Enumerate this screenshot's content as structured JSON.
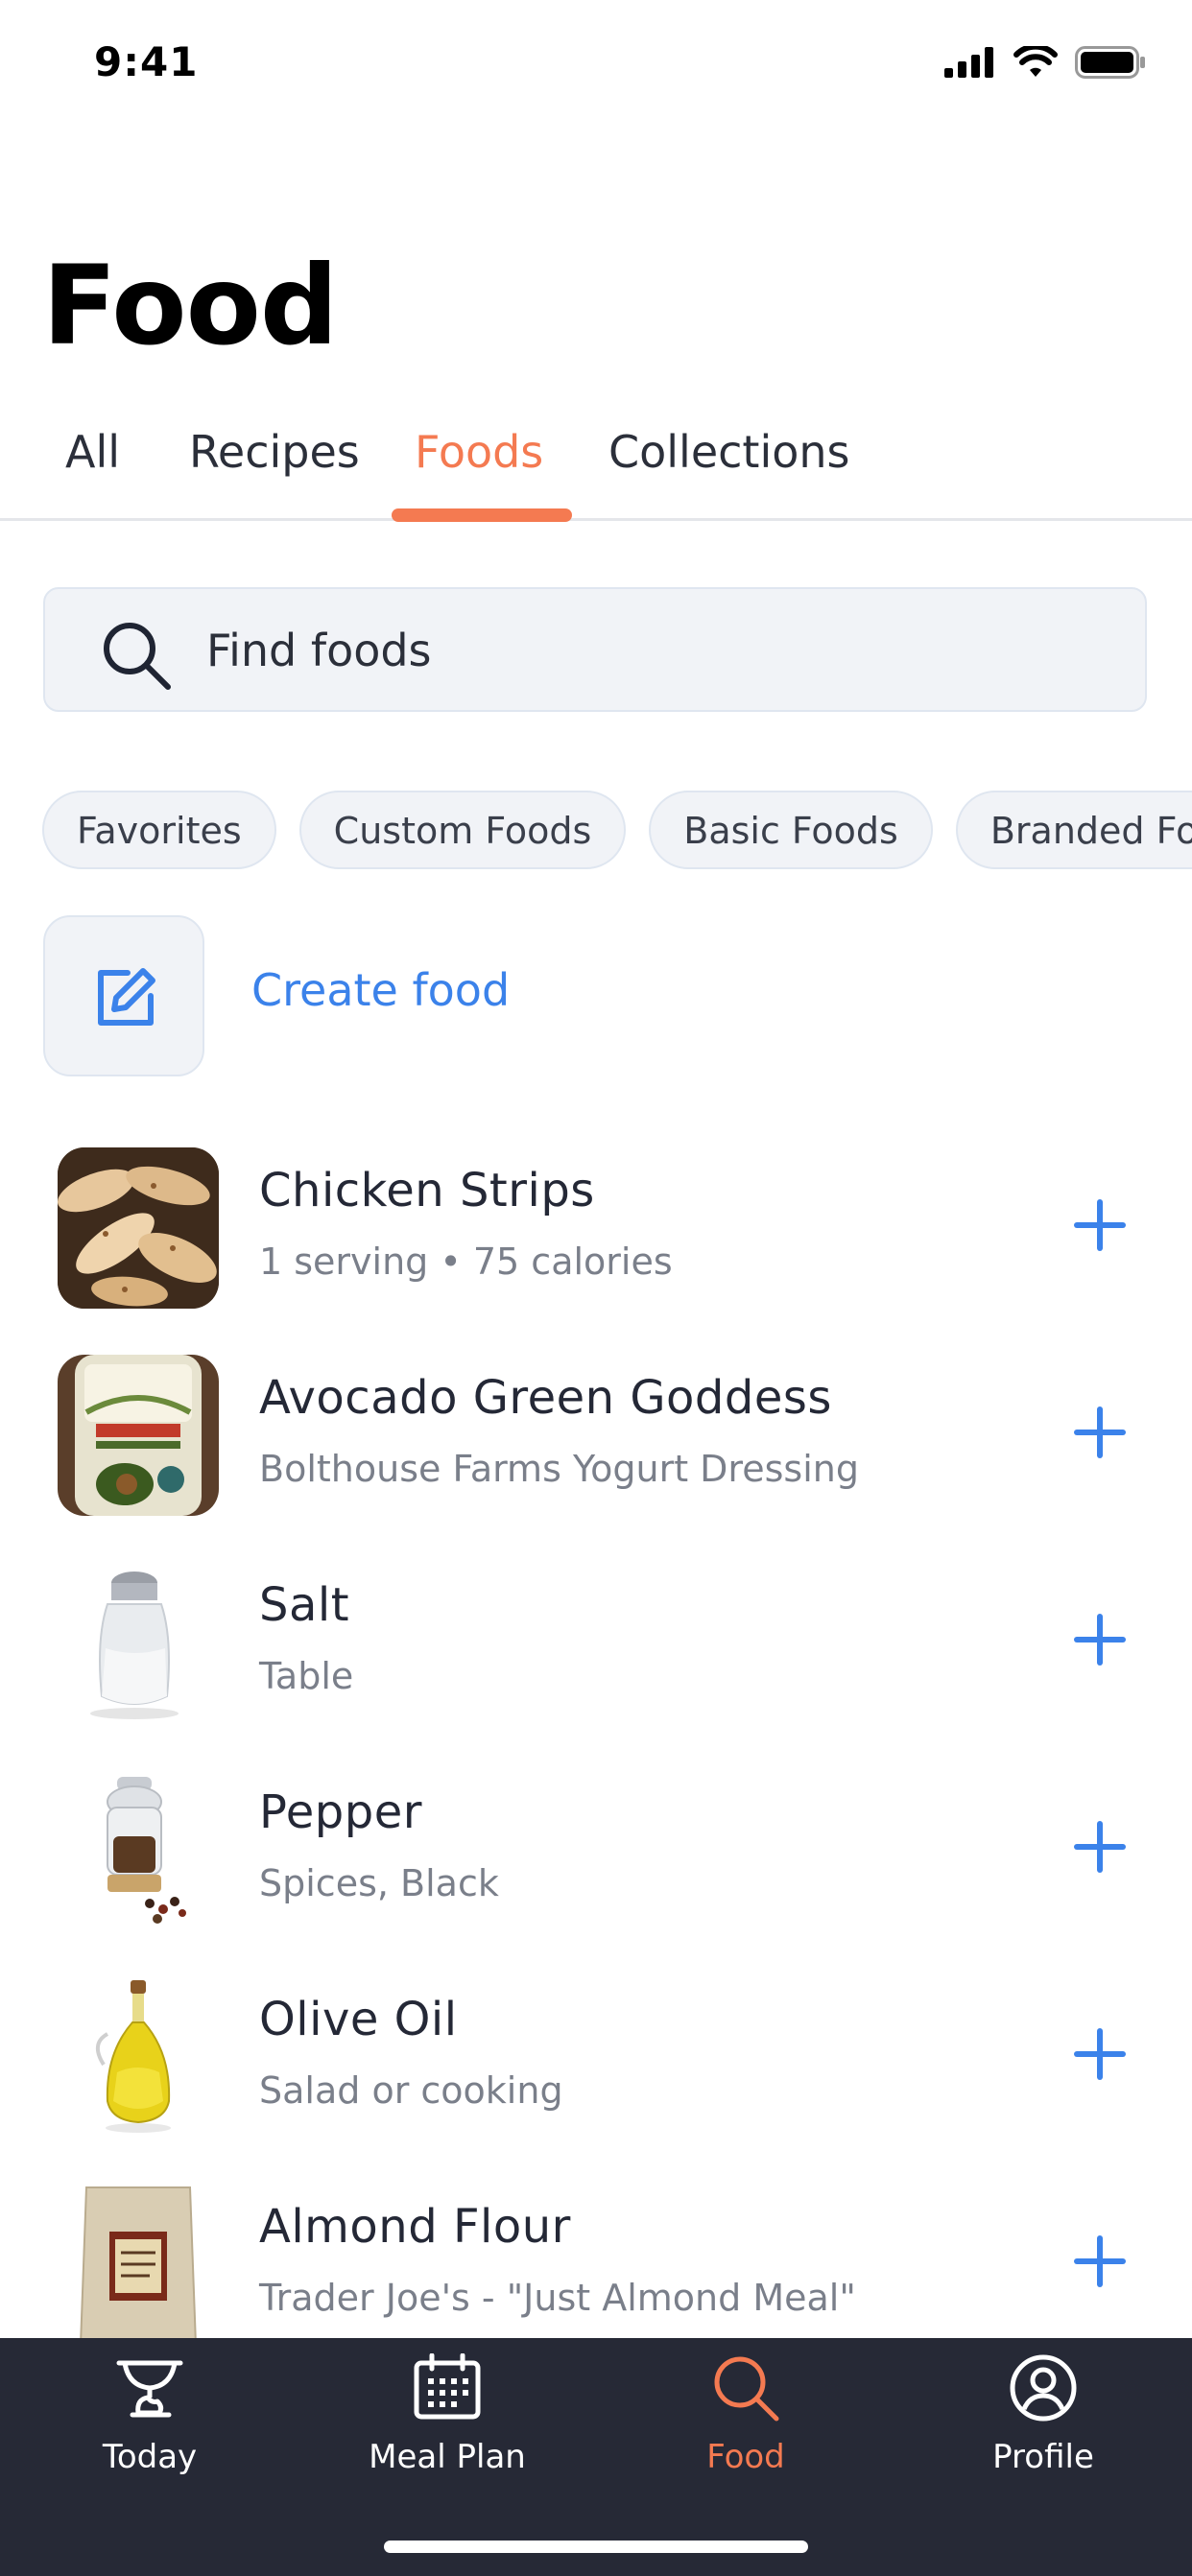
{
  "status_bar": {
    "time": "9:41"
  },
  "page": {
    "title": "Food"
  },
  "tabs": [
    {
      "label": "All"
    },
    {
      "label": "Recipes"
    },
    {
      "label": "Foods"
    },
    {
      "label": "Collections"
    }
  ],
  "active_tab": "Foods",
  "search": {
    "placeholder": "Find foods",
    "value": ""
  },
  "chips": [
    {
      "label": "Favorites"
    },
    {
      "label": "Custom Foods"
    },
    {
      "label": "Basic Foods"
    },
    {
      "label": "Branded Foods"
    }
  ],
  "create_food": {
    "label": "Create food",
    "icon": "edit-icon"
  },
  "foods": [
    {
      "name": "Chicken Strips",
      "subtitle": "1 serving • 75 calories",
      "image": "chicken-strips-photo"
    },
    {
      "name": "Avocado Green Goddess",
      "subtitle": "Bolthouse Farms Yogurt Dressing",
      "image": "dressing-bottle-photo"
    },
    {
      "name": "Salt",
      "subtitle": "Table",
      "image": "salt-shaker-photo"
    },
    {
      "name": "Pepper",
      "subtitle": "Spices, Black",
      "image": "pepper-grinder-photo"
    },
    {
      "name": "Olive Oil",
      "subtitle": "Salad or cooking",
      "image": "olive-oil-bottle-photo"
    },
    {
      "name": "Almond Flour",
      "subtitle": "Trader Joe's - \"Just Almond Meal\"",
      "image": "almond-flour-bag-photo"
    }
  ],
  "bottom_nav": [
    {
      "label": "Today",
      "icon": "scale-icon"
    },
    {
      "label": "Meal Plan",
      "icon": "calendar-icon"
    },
    {
      "label": "Food",
      "icon": "search-icon"
    },
    {
      "label": "Profile",
      "icon": "profile-icon"
    }
  ],
  "active_nav": "Food",
  "colors": {
    "accent": "#f47a51",
    "link": "#3b82ea",
    "nav_bg": "#262936"
  }
}
